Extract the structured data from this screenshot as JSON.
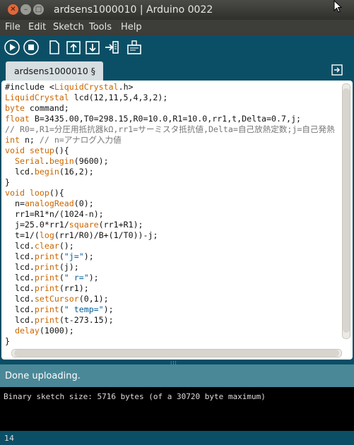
{
  "window": {
    "title": "ardsens1000010 | Arduino 0022"
  },
  "menu": [
    "File",
    "Edit",
    "Sketch",
    "Tools",
    "Help"
  ],
  "toolbar": [
    "verify-icon",
    "stop-icon",
    "new-icon",
    "open-icon",
    "save-icon",
    "upload-icon",
    "serial-monitor-icon"
  ],
  "tab": {
    "label": "ardsens1000010 §"
  },
  "code_lines": [
    "#include <LiquidCrystal.h>",
    "LiquidCrystal lcd(12,11,5,4,3,2);",
    "byte command;",
    "float B=3435.00,T0=298.15,R0=10.0,R1=10.0,rr1,t,Delta=0.7,j;",
    "// R0=,R1=分圧用抵抗器kΩ,rr1=サーミスタ抵抗値,Delta=自己放熱定数;j=自己発熱",
    "int n; // n=アナログ入力値",
    "void setup(){",
    "  Serial.begin(9600);",
    "  lcd.begin(16,2);",
    "}",
    "void loop(){",
    "  n=analogRead(0);",
    "  rr1=R1*n/(1024-n);",
    "  j=25.0*rr1/square(rr1+R1);",
    "  t=1/(log(rr1/R0)/B+(1/T0))-j;",
    "  lcd.clear();",
    "  lcd.print(\"j=\");",
    "  lcd.print(j);",
    "  lcd.print(\" r=\");",
    "  lcd.print(rr1);",
    "  lcd.setCursor(0,1);",
    "  lcd.print(\" temp=\");",
    "  lcd.print(t-273.15);",
    "  delay(1000);",
    "}"
  ],
  "status": {
    "text": "Done uploading."
  },
  "console": {
    "text": "Binary sketch size: 5716 bytes (of a 30720 byte maximum)"
  },
  "line_number": "14"
}
